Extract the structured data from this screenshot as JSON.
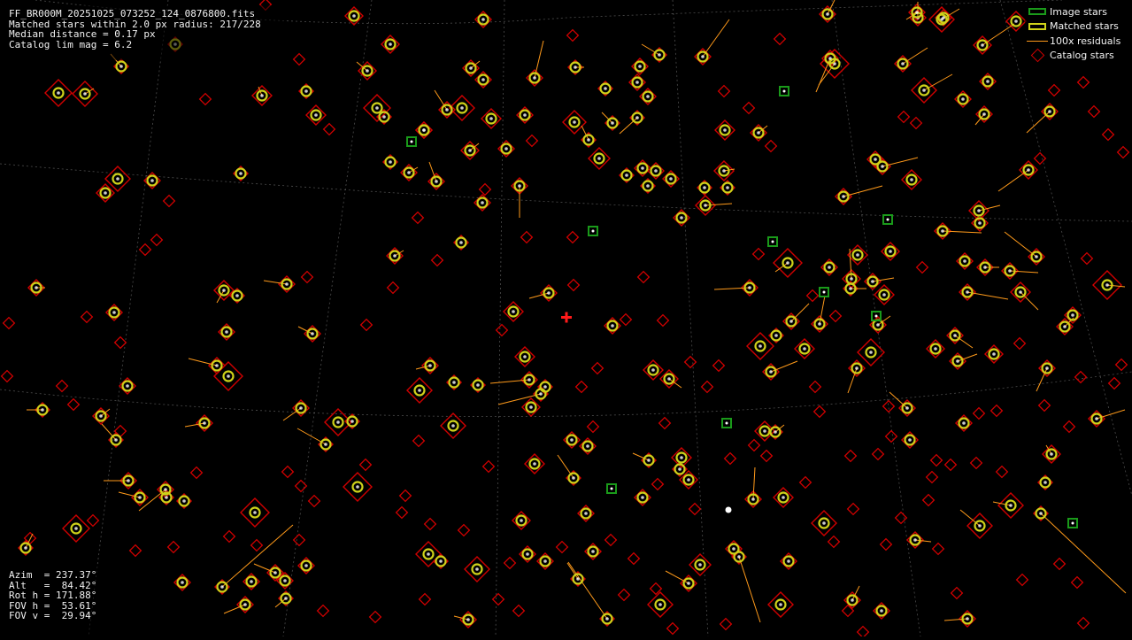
{
  "header": {
    "filename": "FF_BR000M_20251025_073252_124_0876800.fits",
    "matched_line": "Matched stars within 2.0 px radius: 217/228",
    "median_line": "Median distance = 0.17 px",
    "limmag_line": "Catalog lim mag = 6.2"
  },
  "legend": [
    {
      "label": "Image stars",
      "color": "#1a9a1a",
      "icon": "green-box-icon"
    },
    {
      "label": "Matched stars",
      "color": "#cfd21a",
      "icon": "yellow-box-icon"
    },
    {
      "label": "100x residuals",
      "color": "#ff9a1a",
      "icon": "orange-line-icon"
    },
    {
      "label": "Catalog stars",
      "color": "#d10000",
      "icon": "red-diamond-icon"
    }
  ],
  "pointing": {
    "azim": "Azim  = 237.37°",
    "alt": "Alt   =  84.42°",
    "rot": "Rot h = 171.88°",
    "fov_h": "FOV h =  53.61°",
    "fov_v": "FOV v =  29.94°"
  },
  "colors": {
    "matched": "#cfd21a",
    "residual": "#ff9a1a",
    "catalog": "#d10000",
    "image_star": "#1a9a1a",
    "grid": "#8a8a8a",
    "center_marker": "#ff1a1a"
  }
}
